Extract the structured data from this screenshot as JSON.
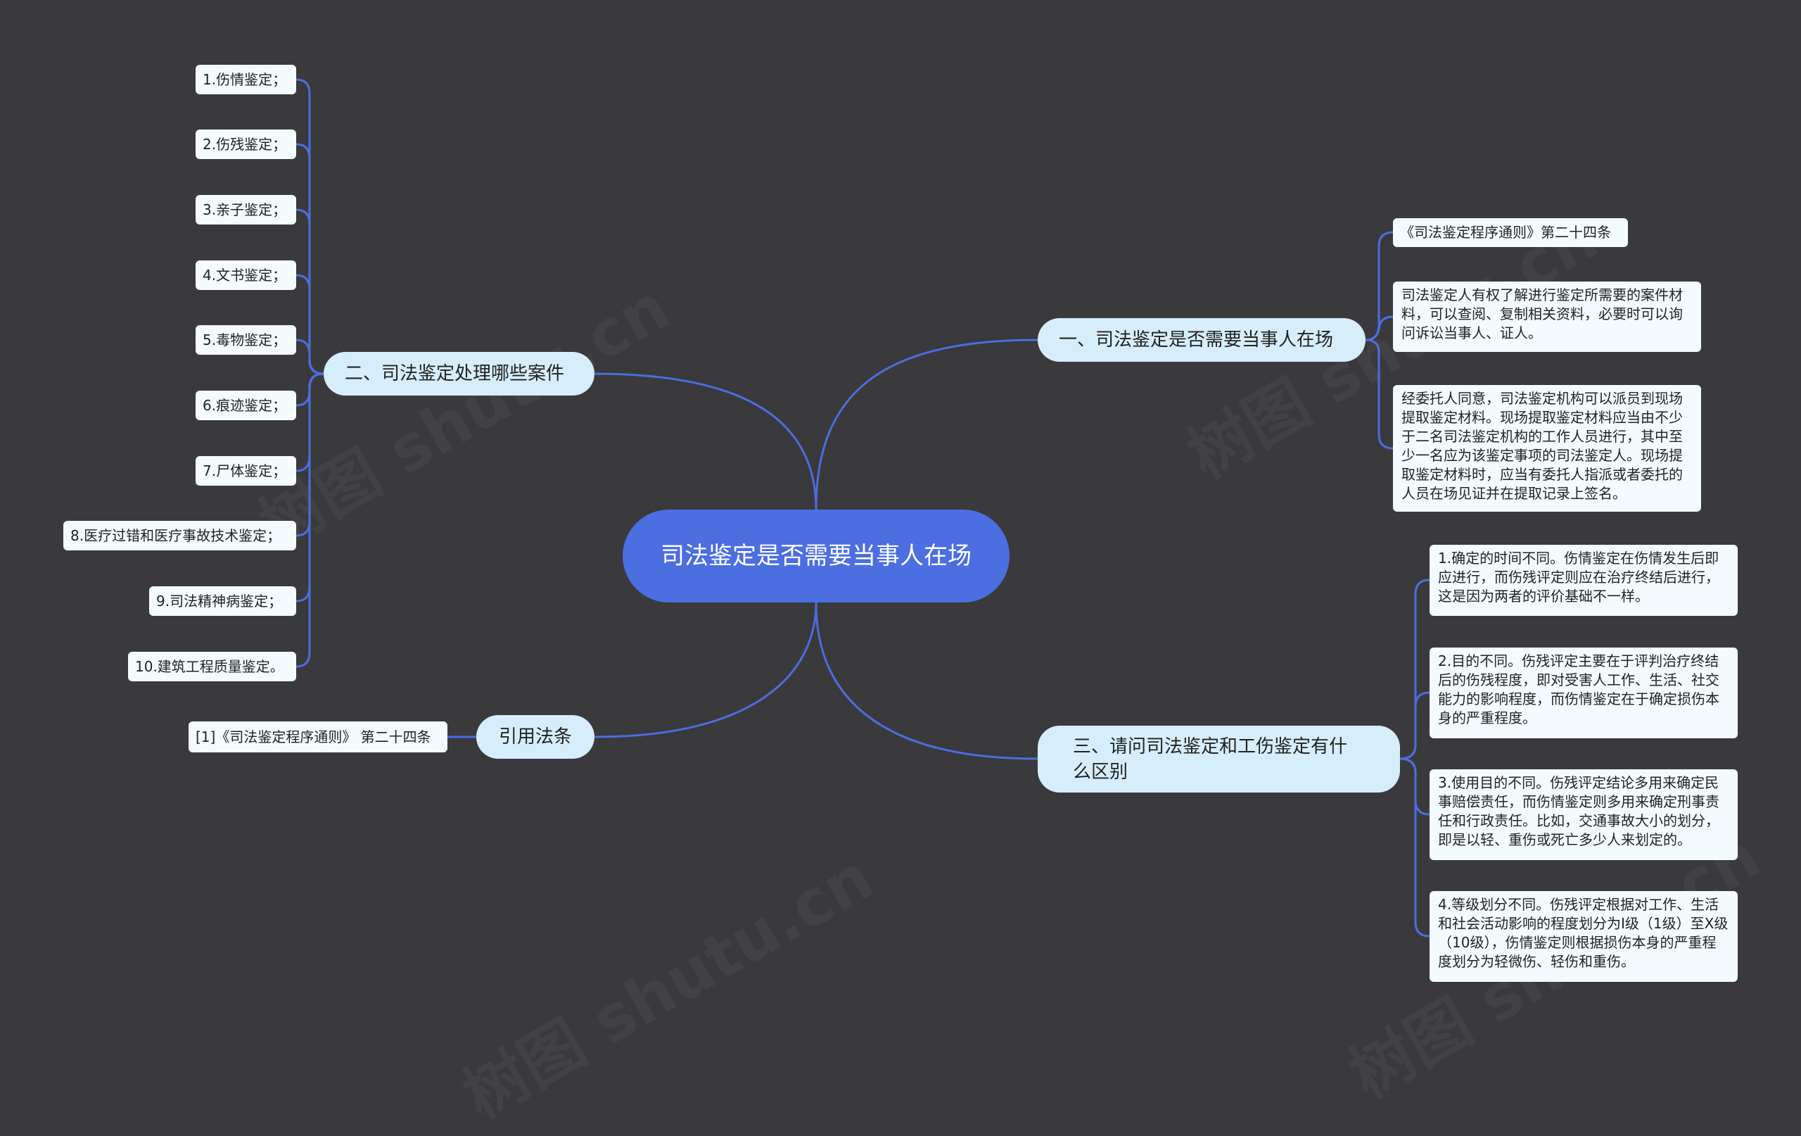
{
  "root": {
    "title": "司法鉴定是否需要当事人在场"
  },
  "branch1": {
    "label": "一、司法鉴定是否需要当事人在场",
    "items": [
      "《司法鉴定程序通则》第二十四条",
      "司法鉴定人有权了解进行鉴定所需要的案件材料，可以查阅、复制相关资料，必要时可以询问诉讼当事人、证人。",
      "经委托人同意，司法鉴定机构可以派员到现场提取鉴定材料。现场提取鉴定材料应当由不少于二名司法鉴定机构的工作人员进行，其中至少一名应为该鉴定事项的司法鉴定人。现场提取鉴定材料时，应当有委托人指派或者委托的人员在场见证并在提取记录上签名。"
    ]
  },
  "branch2": {
    "label": "二、司法鉴定处理哪些案件",
    "items": [
      "1.伤情鉴定；",
      "2.伤残鉴定；",
      "3.亲子鉴定；",
      "4.文书鉴定；",
      "5.毒物鉴定；",
      "6.痕迹鉴定；",
      "7.尸体鉴定；",
      "8.医疗过错和医疗事故技术鉴定；",
      "9.司法精神病鉴定；",
      "10.建筑工程质量鉴定。"
    ]
  },
  "branch3": {
    "label": "三、请问司法鉴定和工伤鉴定有什么区别",
    "items": [
      "1.确定的时间不同。伤情鉴定在伤情发生后即应进行，而伤残评定则应在治疗终结后进行，这是因为两者的评价基础不一样。",
      "2.目的不同。伤残评定主要在于评判治疗终结后的伤残程度，即对受害人工作、生活、社交能力的影响程度，而伤情鉴定在于确定损伤本身的严重程度。",
      "3.使用目的不同。伤残评定结论多用来确定民事赔偿责任，而伤情鉴定则多用来确定刑事责任和行政责任。比如，交通事故大小的划分，即是以轻、重伤或死亡多少人来划定的。",
      "4.等级划分不同。伤残评定根据对工作、生活和社会活动影响的程度划分为I级（1级）至X级（10级），伤情鉴定则根据损伤本身的严重程度划分为轻微伤、轻伤和重伤。"
    ]
  },
  "branch4": {
    "label": "引用法条",
    "items": [
      "[1]《司法鉴定程序通则》 第二十四条"
    ]
  },
  "colors": {
    "background": "#3a393c",
    "root": "#4b6ee0",
    "branch": "#d6eefb",
    "leaf": "#f3fbff",
    "link": "#4b6ee0"
  }
}
